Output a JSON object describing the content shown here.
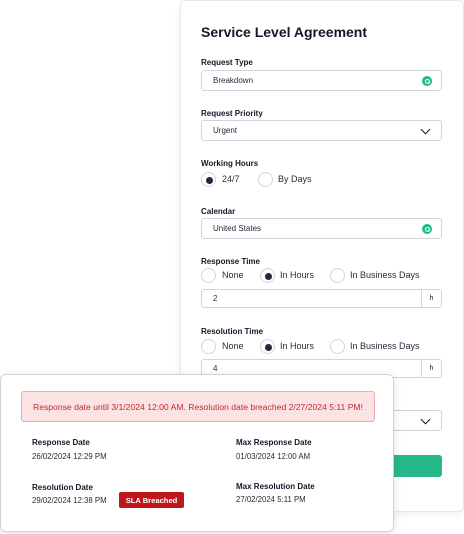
{
  "sla": {
    "title": "Service Level Agreement",
    "request_type": {
      "label": "Request Type",
      "value": "Breakdown",
      "icon": "search-icon"
    },
    "request_priority": {
      "label": "Request Priority",
      "value": "Urgent",
      "icon": "chevron-down-icon"
    },
    "working_hours": {
      "label": "Working Hours",
      "options": [
        "24/7",
        "By Days"
      ],
      "selected": "24/7"
    },
    "calendar": {
      "label": "Calendar",
      "value": "United States",
      "icon": "search-icon"
    },
    "response_time": {
      "label": "Response Time",
      "options": [
        "None",
        "In Hours",
        "In Business Days"
      ],
      "selected": "In Hours",
      "value": "2",
      "unit": "h"
    },
    "resolution_time": {
      "label": "Resolution Time",
      "options": [
        "None",
        "In Hours",
        "In Business Days"
      ],
      "selected": "In Hours",
      "value": "4",
      "unit": "h"
    },
    "accent_color": "#27b98b"
  },
  "overlay": {
    "alert": "Response date until 3/1/2024 12:00 AM. Resolution date breached 2/27/2024 5:11 PM!",
    "response_date": {
      "label": "Response Date",
      "value": "26/02/2024 12:29 PM"
    },
    "max_response_date": {
      "label": "Max Response Date",
      "value": "01/03/2024 12:00 AM"
    },
    "resolution_date": {
      "label": "Resolution Date",
      "value": "29/02/2024 12:38 PM"
    },
    "max_resolution_date": {
      "label": "Max Resolution Date",
      "value": "27/02/2024 5:11 PM"
    },
    "badge": "SLA Breached",
    "badge_color": "#c0171e",
    "alert_color": "#c02a2f"
  }
}
